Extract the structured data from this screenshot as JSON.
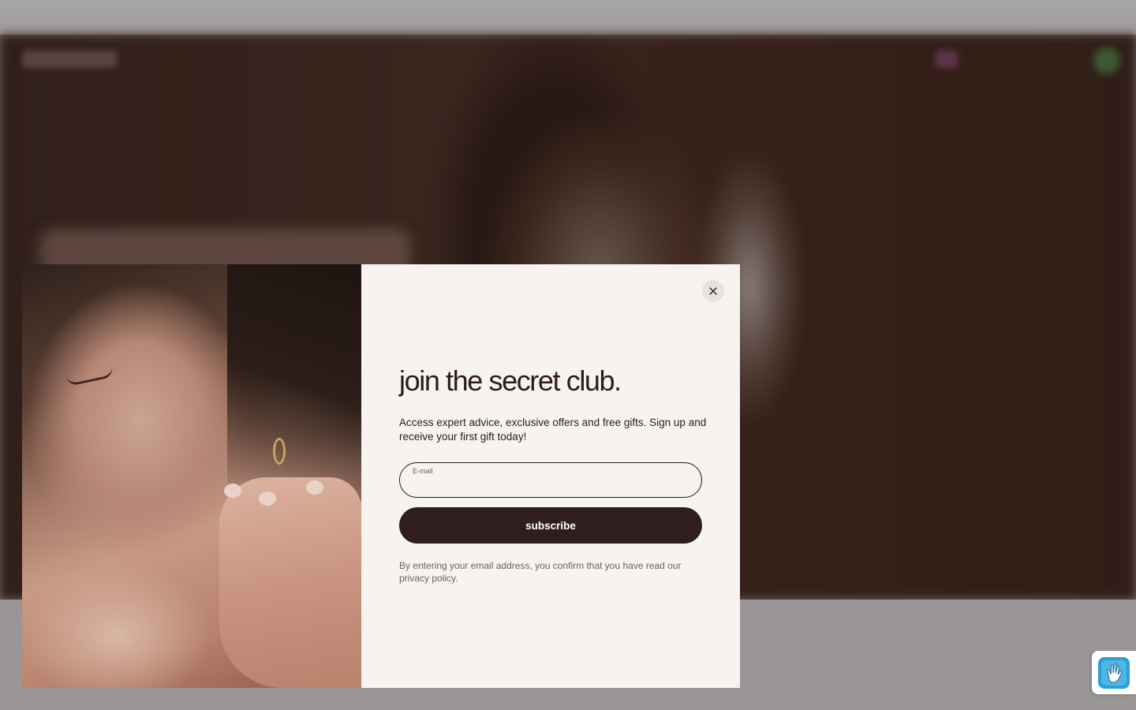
{
  "popup": {
    "headline": "join the secret club.",
    "description": "Access expert advice, exclusive offers and free gifts. Sign up and receive your first gift today!",
    "email_label": "E-mail",
    "email_value": "",
    "email_placeholder": "",
    "subscribe_label": "subscribe",
    "legal_text": "By entering your email address, you confirm that you have read our privacy policy."
  },
  "icons": {
    "close": "close-icon",
    "accessibility": "accessibility-hand-icon"
  },
  "colors": {
    "modal_background": "#f7f3f0",
    "primary_dark": "#2f1d1f",
    "text_dark": "#2d1b1c",
    "legal_text": "#6b5f5e",
    "accessibility_accent": "#2a9fd8"
  }
}
